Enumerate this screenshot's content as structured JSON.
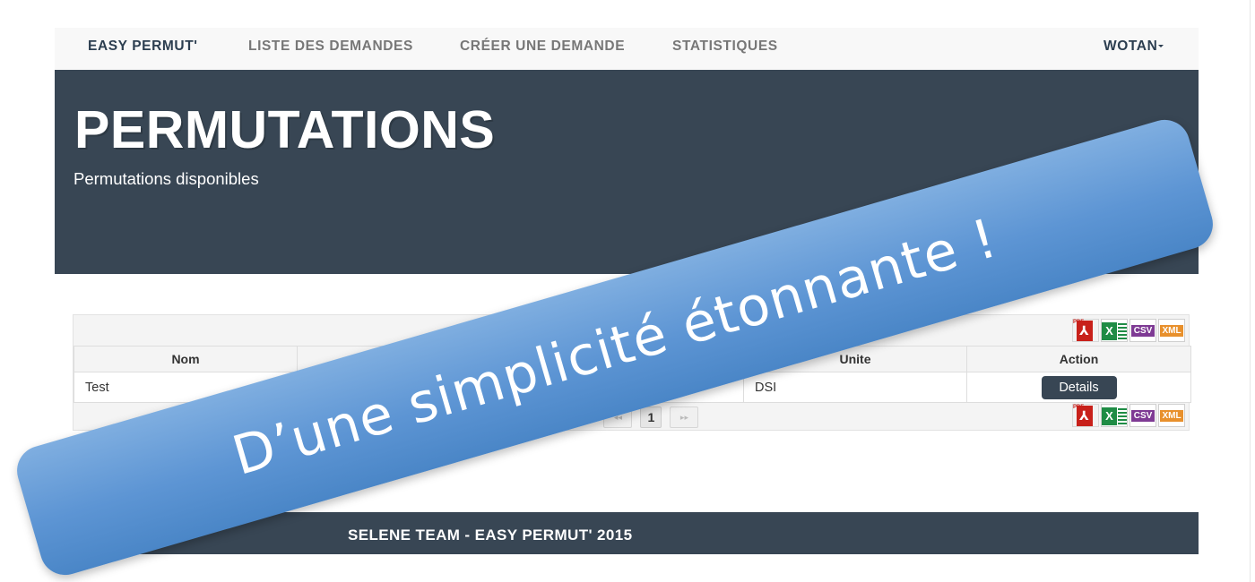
{
  "navbar": {
    "brand": "EASY PERMUT'",
    "links": [
      "LISTE DES DEMANDES",
      "CRÉER UNE DEMANDE",
      "STATISTIQUES"
    ],
    "user": "WOTAN"
  },
  "header": {
    "title": "PERMUTATIONS",
    "subtitle": "Permutations disponibles"
  },
  "table": {
    "export_icons": [
      "pdf-icon",
      "excel-icon",
      "csv-icon",
      "xml-icon"
    ],
    "export_labels": {
      "pdf": "PDF",
      "xls": "X",
      "csv": "CSV",
      "xml": "XML"
    },
    "columns": [
      "Nom",
      "",
      "Unite",
      "Action"
    ],
    "rows": [
      {
        "nom": "Test",
        "unite": "DSI",
        "action": "Details"
      }
    ],
    "pagination": {
      "page_count": "1)",
      "current_page": "1",
      "prev_symbol": "◂◂",
      "next_symbol": "▸▸"
    }
  },
  "footer": {
    "text": "SELENE TEAM - EASY PERMUT' 2015"
  },
  "banner": {
    "text": "D’une simplicité étonnante !"
  },
  "colors": {
    "dark": "#384654",
    "navbar_bg": "#f8f8f8",
    "ribbon": "#5d95d4",
    "pdf": "#c8201a",
    "excel": "#1f8c45",
    "csv": "#7e3a94",
    "xml": "#e8902c"
  }
}
